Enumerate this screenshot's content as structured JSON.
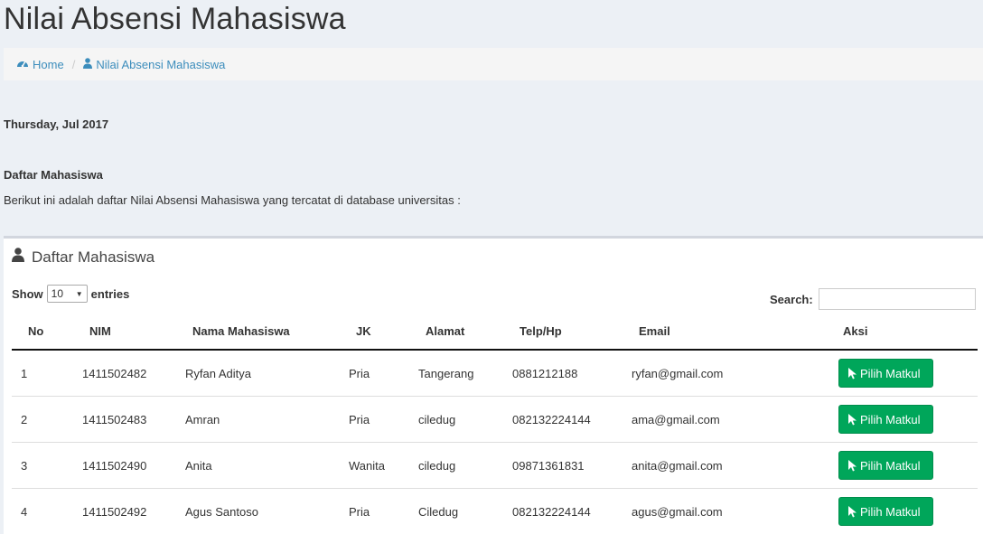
{
  "page": {
    "title": "Nilai Absensi Mahasiswa"
  },
  "breadcrumb": {
    "home_label": "Home",
    "home_icon": "dashboard-icon",
    "current_label": "Nilai Absensi Mahasiswa",
    "current_icon": "user-icon",
    "separator": "/"
  },
  "date": "Thursday, Jul 2017",
  "section": {
    "heading": "Daftar Mahasiswa",
    "intro": "Berikut ini adalah daftar Nilai Absensi Mahasiswa yang tercatat di database universitas :"
  },
  "box": {
    "title": "Daftar Mahasiswa",
    "icon": "user-icon"
  },
  "table_controls": {
    "show_label": "Show",
    "page_length": "10",
    "entries_label": "entries",
    "search_label": "Search:",
    "search_value": ""
  },
  "table": {
    "columns": [
      "No",
      "NIM",
      "Nama Mahasiswa",
      "JK",
      "Alamat",
      "Telp/Hp",
      "Email",
      "Aksi"
    ],
    "rows": [
      {
        "no": "1",
        "nim": "1411502482",
        "nama": "Ryfan Aditya",
        "jk": "Pria",
        "alamat": "Tangerang",
        "telp": "0881212188",
        "email": "ryfan@gmail.com",
        "aksi": "Pilih Matkul"
      },
      {
        "no": "2",
        "nim": "1411502483",
        "nama": "Amran",
        "jk": "Pria",
        "alamat": "ciledug",
        "telp": "082132224144",
        "email": "ama@gmail.com",
        "aksi": "Pilih Matkul"
      },
      {
        "no": "3",
        "nim": "1411502490",
        "nama": "Anita",
        "jk": "Wanita",
        "alamat": "ciledug",
        "telp": "09871361831",
        "email": "anita@gmail.com",
        "aksi": "Pilih Matkul"
      },
      {
        "no": "4",
        "nim": "1411502492",
        "nama": "Agus Santoso",
        "jk": "Pria",
        "alamat": "Ciledug",
        "telp": "082132224144",
        "email": "agus@gmail.com",
        "aksi": "Pilih Matkul"
      }
    ]
  },
  "colors": {
    "accent": "#3c8dbc",
    "button": "#00a65a",
    "background": "#ecf0f5"
  }
}
